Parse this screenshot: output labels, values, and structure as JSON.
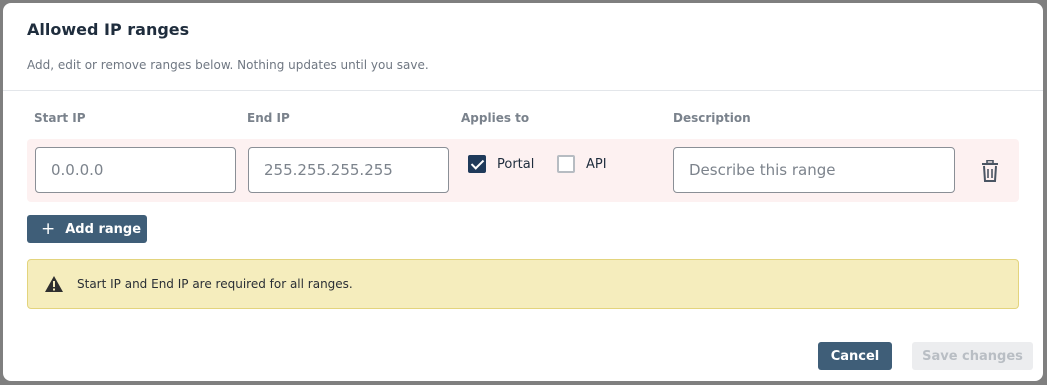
{
  "dialog": {
    "title": "Allowed IP ranges",
    "subtitle": "Add, edit or remove ranges below. Nothing updates until you save."
  },
  "columns": {
    "start_ip": "Start IP",
    "end_ip": "End IP",
    "applies_to": "Applies to",
    "description": "Description"
  },
  "ranges": [
    {
      "start_ip_placeholder": "0.0.0.0",
      "end_ip_placeholder": "255.255.255.255",
      "portal": {
        "label": "Portal",
        "checked": true
      },
      "api": {
        "label": "API",
        "checked": false
      },
      "description_placeholder": "Describe this range",
      "delete_icon": "trash-icon"
    }
  ],
  "add_range": {
    "label": "Add range",
    "icon": "plus-icon"
  },
  "warning": {
    "icon": "warning-triangle-icon",
    "message": "Start IP and End IP are required for all ranges."
  },
  "footer": {
    "cancel_label": "Cancel",
    "save_label": "Save changes"
  },
  "colors": {
    "primary": "#3f5e78",
    "row_bg": "#fdf1f1",
    "warning_bg": "#f5edbd",
    "checkbox_checked": "#1f3a5a"
  }
}
